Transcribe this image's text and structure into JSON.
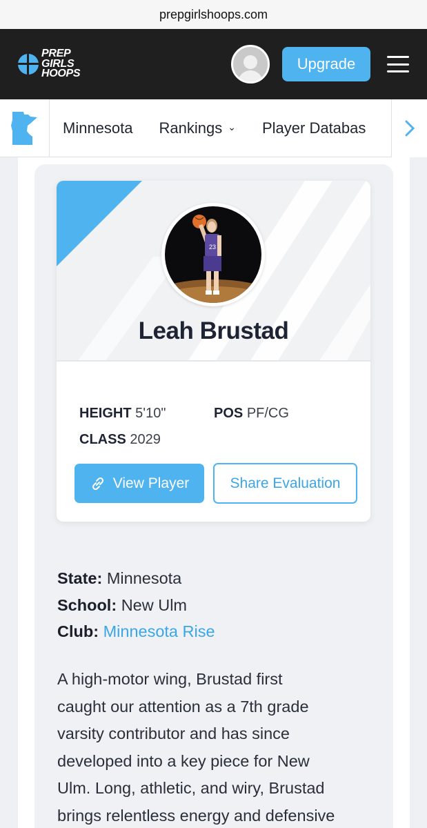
{
  "browser": {
    "url": "prepgirlshoops.com"
  },
  "header": {
    "logo_lines": [
      "PREP",
      "GIRLS",
      "HOOPS"
    ],
    "upgrade_label": "Upgrade"
  },
  "subnav": {
    "items": [
      {
        "label": "Minnesota"
      },
      {
        "label": "Rankings"
      },
      {
        "label": "Player Databas"
      }
    ]
  },
  "player": {
    "name": "Leah Brustad",
    "height_label": "HEIGHT",
    "height_value": "5'10\"",
    "pos_label": "POS",
    "pos_value": "PF/CG",
    "class_label": "CLASS",
    "class_value": "2029",
    "view_button": "View Player",
    "share_button": "Share Evaluation",
    "jersey_number": "23"
  },
  "details": {
    "state_label": "State:",
    "state_value": "Minnesota",
    "school_label": "School:",
    "school_value": "New Ulm",
    "club_label": "Club:",
    "club_value": "Minnesota Rise"
  },
  "evaluation": {
    "lines": [
      "A high-motor wing, Brustad first",
      "caught our attention as a 7th grade",
      "varsity contributor and has since",
      "developed into a key piece for New",
      "Ulm. Long, athletic, and wiry, Brustad",
      "brings relentless energy and defensive"
    ]
  },
  "colors": {
    "accent": "#4fb3ef",
    "topbar": "#1f1f1f"
  }
}
